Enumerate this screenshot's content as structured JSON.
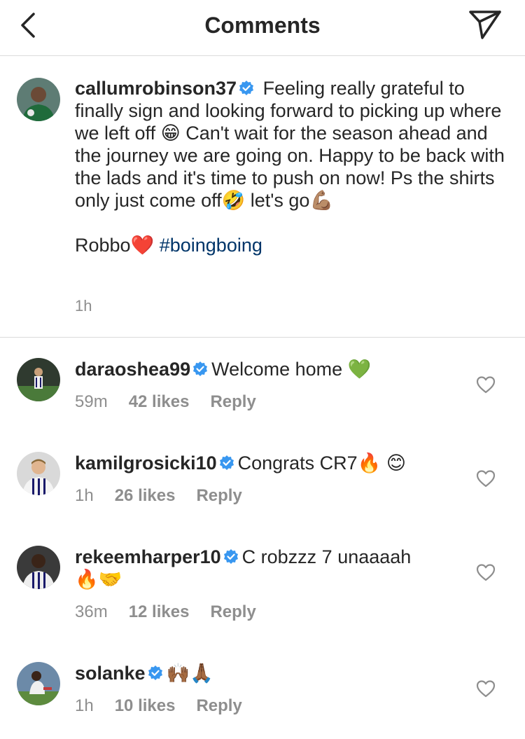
{
  "header": {
    "title": "Comments",
    "back_icon": "chevron-left-icon",
    "share_icon": "paper-plane-icon"
  },
  "caption": {
    "username": "callumrobinson37",
    "verified": true,
    "text_part1": " Feeling really grateful to finally sign and looking forward to picking up where we left off ",
    "emoji1": "😁",
    "text_part2": " Can't wait for the season ahead and the journey we are going on. Happy to be back with the lads and it's time to push on now! Ps the shirts only just come off",
    "emoji2": "🤣",
    "text_part3": " let's go",
    "emoji3": "💪🏽",
    "signoff": "Robbo",
    "emoji4": "❤️",
    "hashtag": "#boingboing",
    "time": "1h"
  },
  "comments": [
    {
      "username": "daraoshea99",
      "text": "Welcome home ",
      "emoji": "💚",
      "time": "59m",
      "likes": "42 likes",
      "reply": "Reply"
    },
    {
      "username": "kamilgrosicki10",
      "text": "Congrats CR7",
      "emoji": "🔥 😊",
      "time": "1h",
      "likes": "26 likes",
      "reply": "Reply"
    },
    {
      "username": "rekeemharper10",
      "text": "C robzzz 7 unaaaah",
      "emoji": "🔥🤝",
      "time": "36m",
      "likes": "12 likes",
      "reply": "Reply"
    },
    {
      "username": "solanke",
      "text": "",
      "emoji": "🙌🏾🙏🏾",
      "time": "1h",
      "likes": "10 likes",
      "reply": "Reply"
    }
  ],
  "colors": {
    "text": "#262626",
    "secondary": "#8e8e8e",
    "hashtag": "#003569",
    "verified": "#3897f0",
    "divider": "#dbdbdb"
  }
}
